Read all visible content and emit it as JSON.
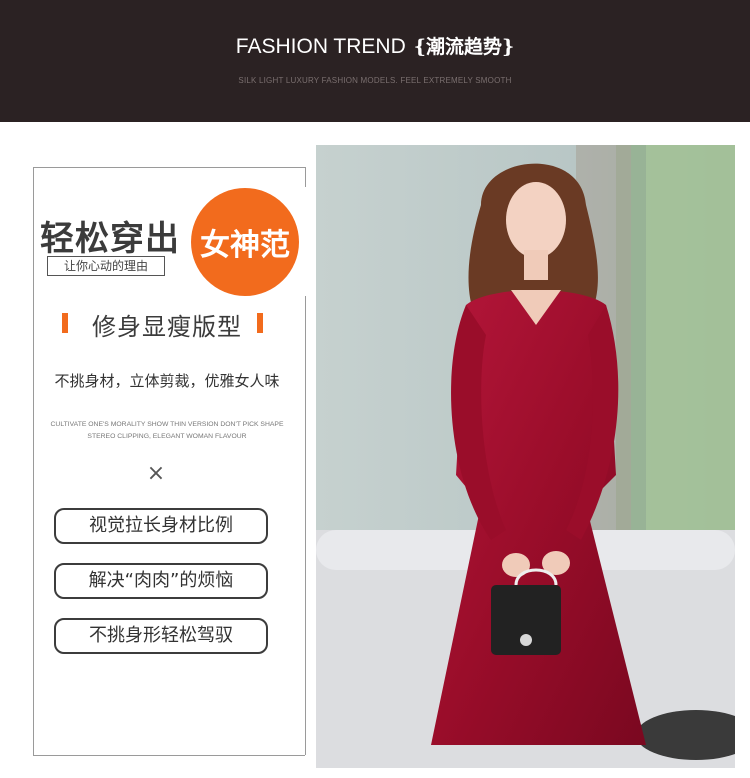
{
  "header": {
    "title_en": "FASHION TREND",
    "title_cn": "{潮流趋势}",
    "subtitle": "SILK LIGHT LUXURY FASHION MODELS. FEEL EXTREMELY SMOOTH"
  },
  "left": {
    "big_title": "轻松穿出",
    "badge": "女神范",
    "reason": "让你心动的理由",
    "feature_title": "修身显瘦版型",
    "desc": "不挑身材，立体剪裁，优雅女人味",
    "en_line1": "CULTIVATE ONE'S MORALITY SHOW THIN VERSION DON'T PICK SHAPE",
    "en_line2": "STEREO CLIPPING, ELEGANT WOMAN FLAVOUR",
    "cross": "×",
    "pills": [
      "视觉拉长身材比例",
      "解决“肉肉”的烦恼",
      "不挑身形轻松驾驭"
    ]
  },
  "colors": {
    "header_bg": "#2b2223",
    "accent": "#f26b1d",
    "dress": "#a8102e"
  }
}
